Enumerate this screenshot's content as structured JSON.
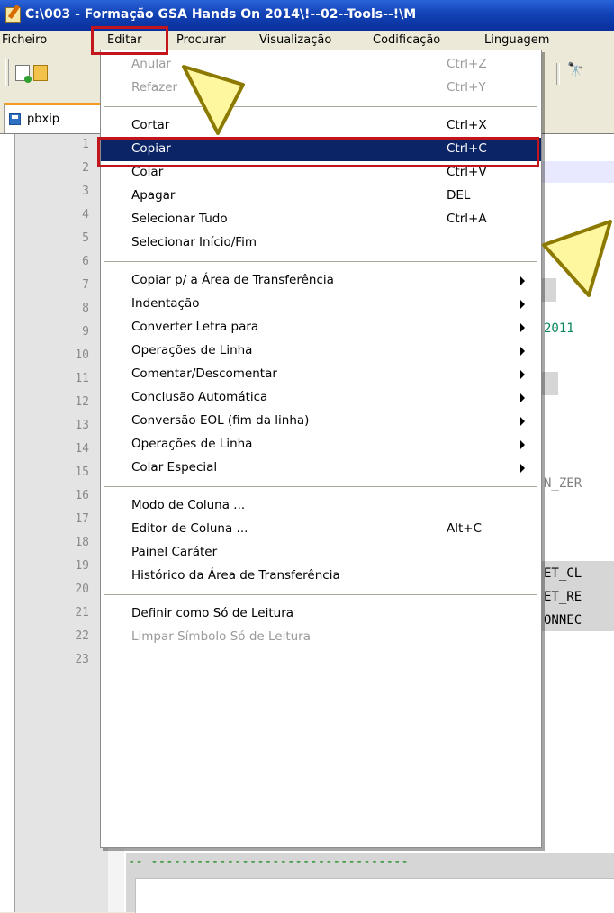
{
  "window": {
    "title": "C:\\003 - Formação GSA Hands On 2014\\!--02--Tools--!\\M"
  },
  "menubar": {
    "items": [
      "Ficheiro",
      "Editar",
      "Procurar",
      "Visualização",
      "Codificação",
      "Linguagem"
    ]
  },
  "tab": {
    "label": "pbxip"
  },
  "editor": {
    "line_numbers": [
      "1",
      "2",
      "3",
      "4",
      "5",
      "6",
      "7",
      "8",
      "9",
      "10",
      "11",
      "12",
      "13",
      "14",
      "15",
      "16",
      "17",
      "18",
      "19",
      "20",
      "21",
      "22",
      "23"
    ],
    "code_fragments": {
      "line6": "2011",
      "line10": "N_ZER",
      "line13": "ET_CL",
      "line14": "ET_RE",
      "line15": "ONNEC",
      "line22": "-- ----------------------------------"
    }
  },
  "edit_menu": {
    "undo": {
      "label": "Anular",
      "shortcut": "Ctrl+Z"
    },
    "redo": {
      "label": "Refazer",
      "shortcut": "Ctrl+Y"
    },
    "cut": {
      "label": "Cortar",
      "shortcut": "Ctrl+X"
    },
    "copy": {
      "label": "Copiar",
      "shortcut": "Ctrl+C"
    },
    "paste": {
      "label": "Colar",
      "shortcut": "Ctrl+V"
    },
    "delete": {
      "label": "Apagar",
      "shortcut": "DEL"
    },
    "select_all": {
      "label": "Selecionar Tudo",
      "shortcut": "Ctrl+A"
    },
    "select_begin_end": {
      "label": "Selecionar Início/Fim"
    },
    "copy_clipboard": {
      "label": "Copiar p/ a Área de Transferência"
    },
    "indent": {
      "label": "Indentação"
    },
    "convert_case": {
      "label": "Converter Letra para"
    },
    "line_ops": {
      "label": "Operações de Linha"
    },
    "comment": {
      "label": "Comentar/Descomentar"
    },
    "autocomplete": {
      "label": "Conclusão Automática"
    },
    "eol": {
      "label": "Conversão EOL (fim da linha)"
    },
    "line_ops2": {
      "label": "Operações de Linha"
    },
    "paste_special": {
      "label": "Colar Especial"
    },
    "column_mode": {
      "label": "Modo de Coluna ..."
    },
    "column_editor": {
      "label": "Editor de Coluna ...",
      "shortcut": "Alt+C"
    },
    "char_panel": {
      "label": "Painel Caráter"
    },
    "clipboard_history": {
      "label": "Histórico da Área de Transferência"
    },
    "set_readonly": {
      "label": "Definir como Só de Leitura"
    },
    "clear_readonly": {
      "label": "Limpar Símbolo Só de Leitura"
    }
  },
  "colors": {
    "highlight": "#0b2466",
    "annotation": "#c3161c",
    "pointer_fill": "#fff7a0"
  }
}
